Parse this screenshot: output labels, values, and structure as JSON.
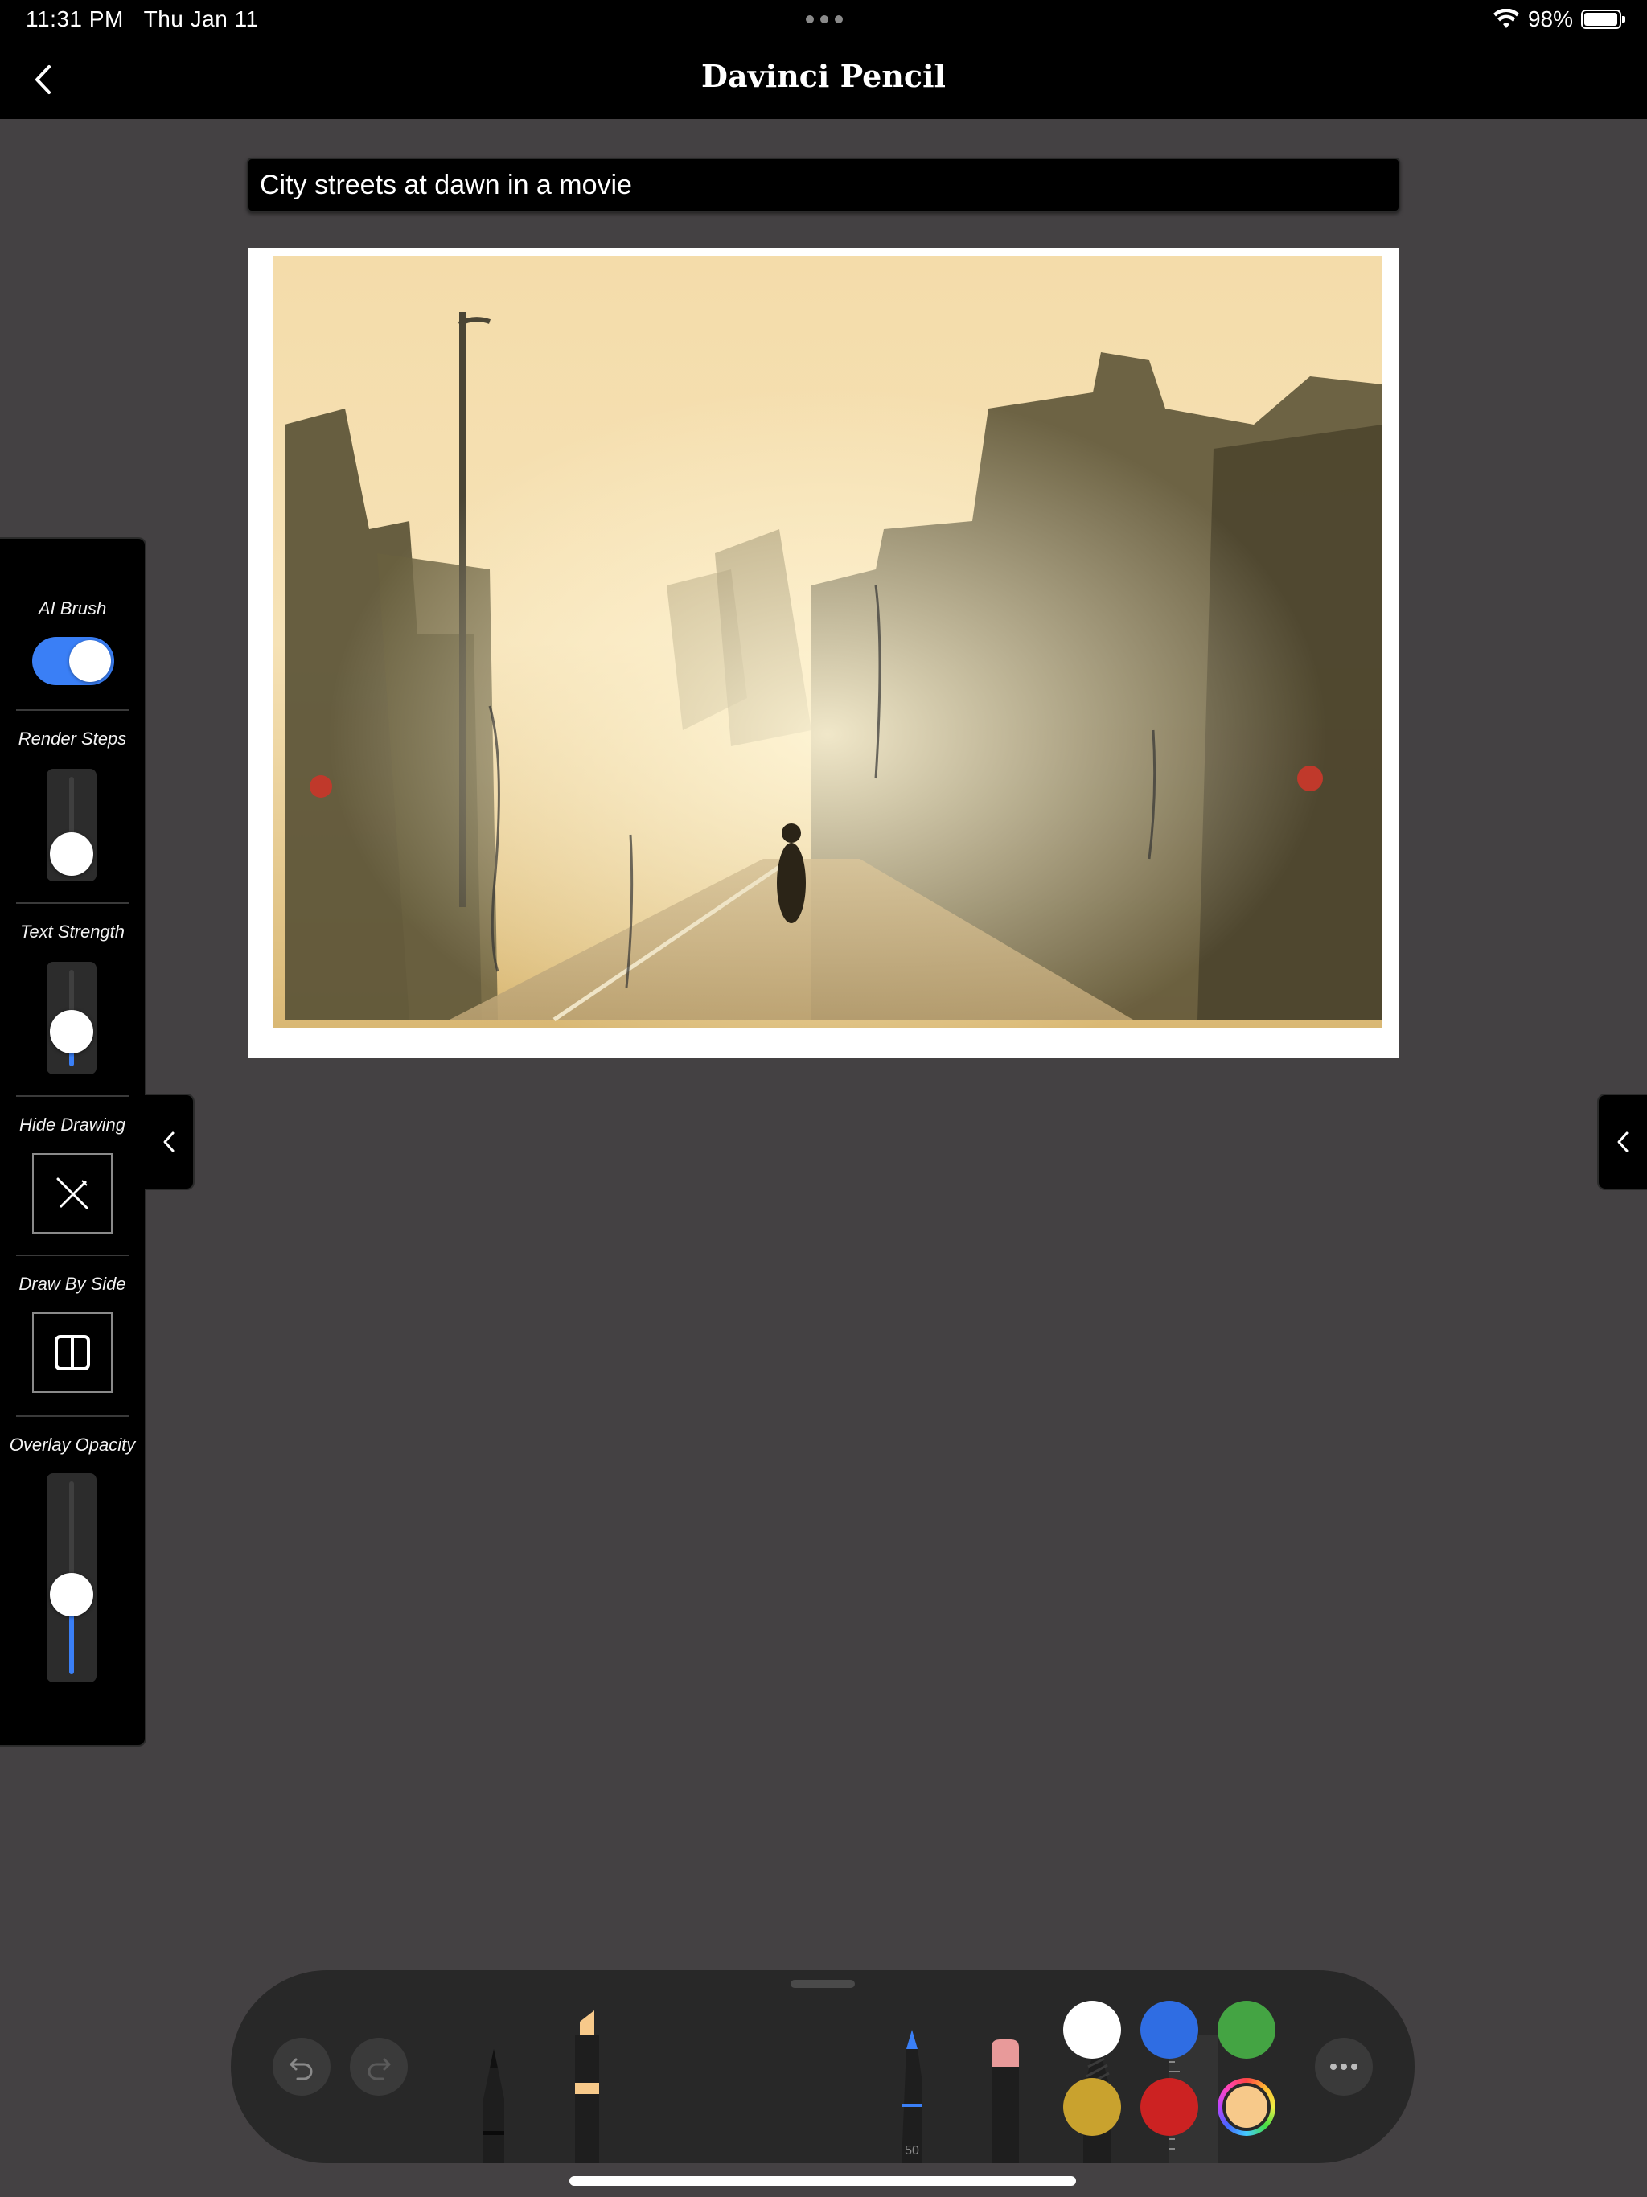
{
  "status": {
    "time": "11:31 PM",
    "date": "Thu Jan 11",
    "battery": "98%",
    "battery_level": 0.98
  },
  "nav": {
    "title": "Davinci Pencil",
    "back_icon": "chevron-left-icon"
  },
  "prompt": {
    "value": "City streets at dawn in a movie"
  },
  "panel": {
    "ai_brush_label": "AI Brush",
    "ai_brush_on": true,
    "render_steps_label": "Render Steps",
    "render_steps_level": 0.08,
    "text_strength_label": "Text Strength",
    "text_strength_level": 0.3,
    "hide_drawing_label": "Hide Drawing",
    "hide_drawing_icon": "pen-slash-icon",
    "draw_by_side_label": "Draw By Side",
    "draw_by_side_icon": "split-view-icon",
    "overlay_opacity_label": "Overlay Opacity",
    "overlay_opacity_level": 0.4
  },
  "tools": {
    "undo_icon": "undo-icon",
    "redo_icon": "redo-icon",
    "pen_size": "50",
    "more_icon": "ellipsis-icon",
    "items": [
      "pen",
      "marker",
      "fineliner",
      "eraser",
      "lasso",
      "ruler"
    ]
  },
  "colors": {
    "white": "#ffffff",
    "blue": "#2f6de3",
    "green": "#44a443",
    "gold": "#c9a22e",
    "red": "#cc2222",
    "selected": "#f7c98a",
    "accent": "#3a7ff6",
    "background": "#444143"
  }
}
